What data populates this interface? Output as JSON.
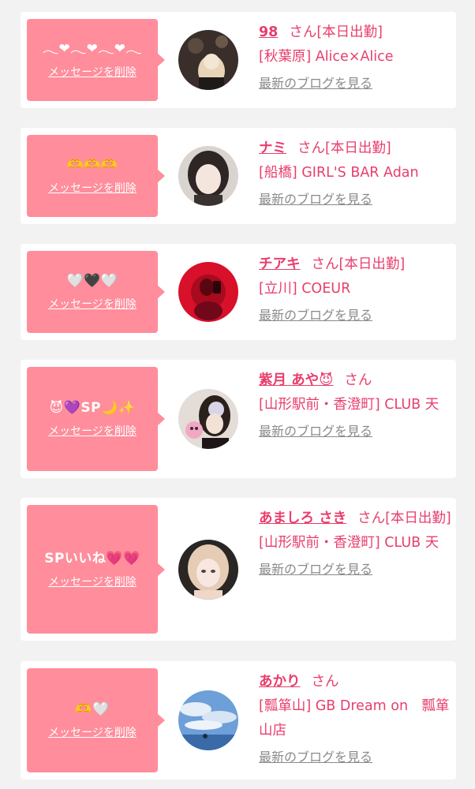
{
  "common": {
    "delete_label": "メッセージを削除",
    "blog_label": "最新のブログを見る",
    "honorific": "さん"
  },
  "colors": {
    "bubble": "#ff8d9b",
    "accent_text": "#e83e6c",
    "muted_text": "#8a8a8a",
    "background": "#f2f2f2",
    "card": "#ffffff"
  },
  "messages": [
    {
      "text": "𓂃❤︎𓂃❤︎𓂃❤︎𓂃",
      "name": "98",
      "status": "[本日出勤]",
      "shop": "[秋葉原] Alice×Alice",
      "avatar_icon": "photo-dark-figure"
    },
    {
      "text": "🫶🫶🫶",
      "name": "ナミ",
      "status": "[本日出勤]",
      "shop": "[船橋] GIRL'S BAR Adan",
      "avatar_icon": "photo-portrait-dark-hair"
    },
    {
      "text": "🤍🖤🤍",
      "name": "チアキ",
      "status": "[本日出勤]",
      "shop": "[立川] COEUR",
      "avatar_icon": "photo-red-room"
    },
    {
      "text": "😈💜SP🌙✨",
      "name": "紫月 あや😈",
      "status": "",
      "shop": "[山形駅前・香澄町] CLUB 天",
      "avatar_icon": "photo-portrait-with-toy"
    },
    {
      "text": "SPいいね💗💗",
      "name": "あましろ さき",
      "status": "[本日出勤]",
      "shop": "[山形駅前・香澄町] CLUB 天",
      "avatar_icon": "photo-portrait-blonde"
    },
    {
      "text": "🫶🤍",
      "name": "あかり",
      "status": "",
      "shop": "[瓢箪山] GB Dream on　瓢箪山店",
      "avatar_icon": "photo-sky-landscape"
    }
  ]
}
